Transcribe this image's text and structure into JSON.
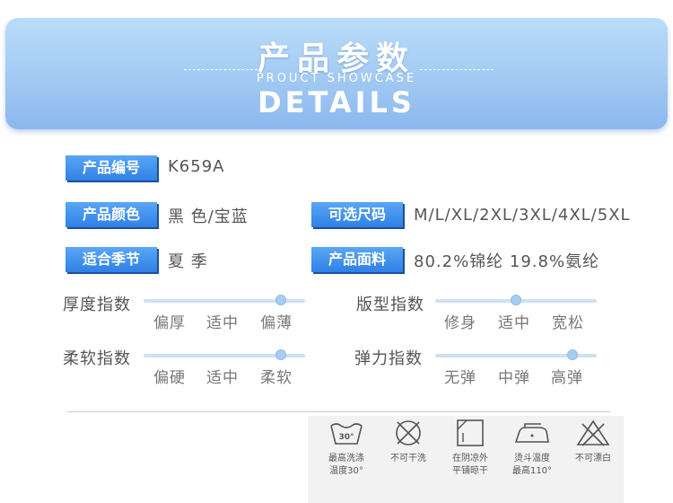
{
  "header": {
    "title": "产品参数",
    "subtitle": "PROUCT SHOWCASE",
    "title_en": "DETAILS"
  },
  "specs": {
    "code_label": "产品编号",
    "code_value": "K659A",
    "color_label": "产品颜色",
    "color_value": "黑 色/宝蓝",
    "size_label": "可选尺码",
    "size_value": "M/L/XL/2XL/3XL/4XL/5XL",
    "season_label": "适合季节",
    "season_value": "夏 季",
    "fabric_label": "产品面料",
    "fabric_value": "80.2%锦纶 19.8%氨纶"
  },
  "indices": {
    "thickness": {
      "label": "厚度指数",
      "options": [
        "偏厚",
        "适中",
        "偏薄"
      ],
      "level": 0.85
    },
    "fit": {
      "label": "版型指数",
      "options": [
        "修身",
        "适中",
        "宽松"
      ],
      "level": 0.5
    },
    "softness": {
      "label": "柔软指数",
      "options": [
        "偏硬",
        "适中",
        "柔软"
      ],
      "level": 0.85
    },
    "elasticity": {
      "label": "弹力指数",
      "options": [
        "无弹",
        "中弹",
        "高弹"
      ],
      "level": 0.85
    }
  },
  "care": {
    "wash": {
      "icon": "wash-30-icon",
      "line1": "最高洗涤",
      "line2": "温度30°",
      "badge": "30°"
    },
    "no_dry": {
      "icon": "no-tumble-dry-icon",
      "line1": "不可干洗",
      "line2": ""
    },
    "shade_dry": {
      "icon": "shade-flat-dry-icon",
      "line1": "在阴凉外",
      "line2": "平铺晾干"
    },
    "iron": {
      "icon": "iron-icon",
      "line1": "烫斗温度",
      "line2": "最高110°"
    },
    "no_bleach": {
      "icon": "no-bleach-icon",
      "line1": "不可漂白",
      "line2": ""
    }
  },
  "colors": {
    "label_blue": "#2f80e6",
    "banner_blue": "#a6cdf4",
    "knob": "#a8cdf2"
  }
}
